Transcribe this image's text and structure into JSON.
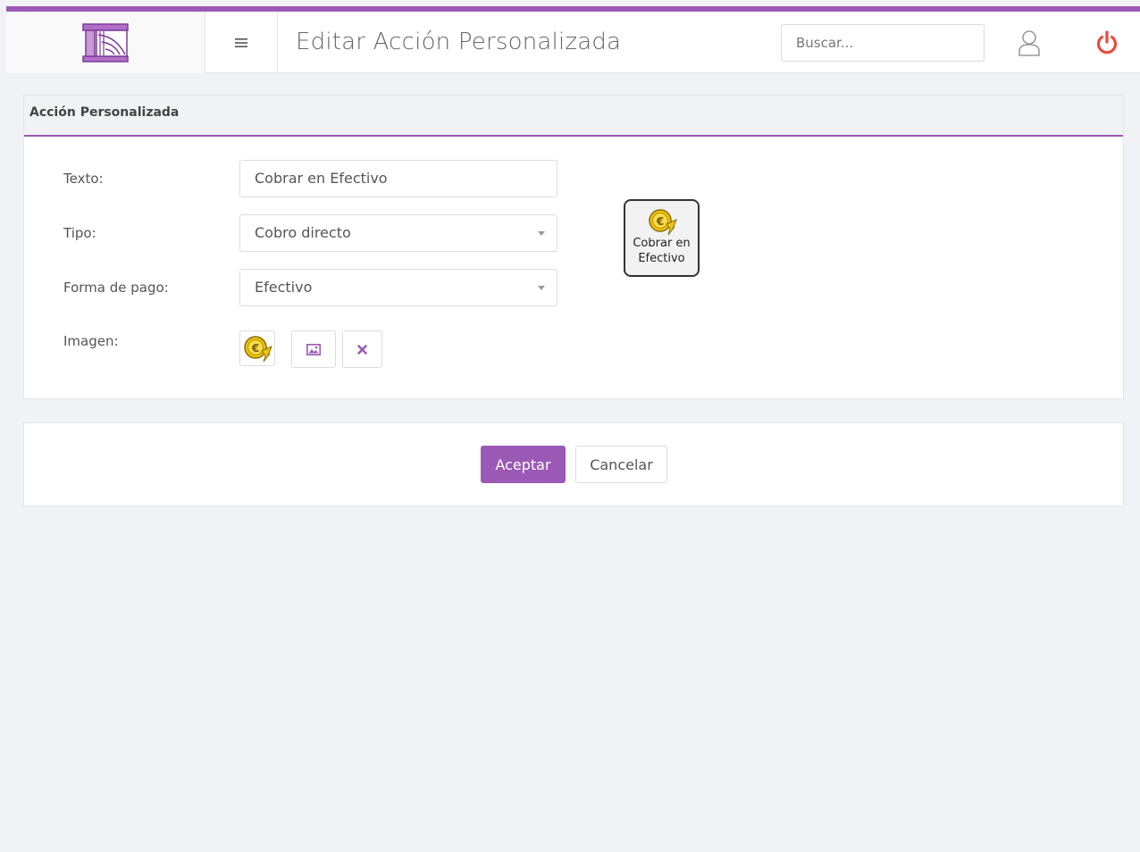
{
  "header": {
    "logo_icon": "columns-logo-icon",
    "menu_icon": "hamburger-icon",
    "title": "Editar Acción Personalizada",
    "search_placeholder": "Buscar...",
    "user_icon": "user-icon",
    "power_icon": "power-icon"
  },
  "colors": {
    "accent": "#9b59b6",
    "power": "#e74c3c",
    "coin": "#f1c40f"
  },
  "panel": {
    "title": "Acción Personalizada",
    "fields": {
      "texto": {
        "label": "Texto:",
        "value": "Cobrar en Efectivo"
      },
      "tipo": {
        "label": "Tipo:",
        "value": "Cobro directo"
      },
      "forma_pago": {
        "label": "Forma de pago:",
        "value": "Efectivo"
      },
      "imagen": {
        "label": "Imagen:",
        "image_icon": "euro-coin-icon",
        "select_icon": "image-icon",
        "clear_icon": "close-icon"
      }
    },
    "preview": {
      "icon": "euro-coin-icon",
      "label": "Cobrar en Efectivo"
    }
  },
  "actions": {
    "accept_label": "Aceptar",
    "cancel_label": "Cancelar"
  }
}
